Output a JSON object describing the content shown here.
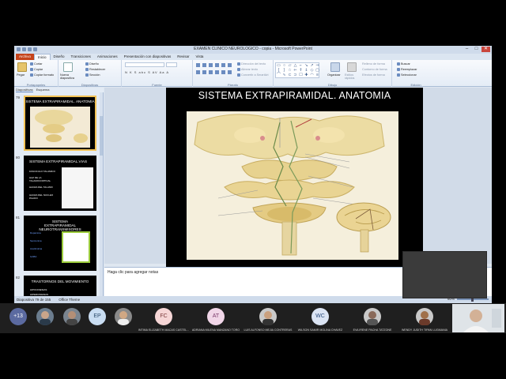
{
  "window": {
    "title": "EXAMEN CLINICO NEUROLOGICO - copia - Microsoft PowerPoint",
    "controls": [
      "–",
      "□",
      "✕"
    ]
  },
  "tabs": [
    "Archivo",
    "Inicio",
    "Diseño",
    "Transiciones",
    "Animaciones",
    "Presentación con diapositivas",
    "Revisar",
    "Vista"
  ],
  "ribbon": {
    "clipboard": {
      "paste": "Pegar",
      "cut": "Cortar",
      "copy": "Copiar",
      "copy_format": "Copiar formato",
      "label": "Portapapeles"
    },
    "slides": {
      "new_slide": "Nueva diapositiva",
      "layout": "Diseño",
      "reset": "Restablecer",
      "section": "Sección",
      "label": "Diapositivas"
    },
    "font": {
      "label": "Fuente",
      "format_row": "N K S abc S AV Aa A"
    },
    "paragraph": {
      "label": "Párrafo",
      "text_dir": "Dirección del texto",
      "align_text": "Alinear texto",
      "smartart": "Convertir a SmartArt"
    },
    "drawing": {
      "label": "Dibujo",
      "arrange": "Organizar",
      "quick_styles": "Estilos rápidos",
      "fill": "Relleno de forma",
      "outline": "Contorno de forma",
      "effects": "Efectos de forma"
    },
    "editing": {
      "label": "Edición",
      "find": "Buscar",
      "replace": "Reemplazar",
      "select": "Seleccionar"
    }
  },
  "panel_tabs": [
    "Diapositivas",
    "Esquema"
  ],
  "thumbnails": [
    {
      "num": "79",
      "title": "SISTEMA EXTRAPIRAMIDAL. ANATOMIA",
      "selected": true
    },
    {
      "num": "80",
      "title": "SISTEMA EXTRAPIRAMIDAL.VIAS",
      "bullets": [
        "FASCICULO TALAMICO",
        "HAZ DE LA TALAMOCORTICAL",
        "HACES DEL TALAMO",
        "HACES DEL NUCLEO PALIDO"
      ],
      "selected": false
    },
    {
      "num": "81",
      "title": "SISTEMA EXTRAPIRAMIDAL NEUROTRANSMISORES",
      "bullets": [
        "Dopamina",
        "Serotonina",
        "Acetilcolina",
        "GABA"
      ],
      "selected": false
    },
    {
      "num": "82",
      "title": "TRASTORNOS DEL MOVIMIENTO",
      "bullets": [
        "HIPOCINESIAS",
        "HIPERCINESIAS"
      ],
      "selected": false
    }
  ],
  "slide": {
    "title": "SISTEMA EXTRAPIRAMIDAL. ANATOMIA"
  },
  "notes_placeholder": "Haga clic para agregar notas",
  "status": {
    "slide_info": "Diapositiva 79 de 155",
    "theme": "Office Theme",
    "zoom": "60%"
  },
  "meeting": {
    "overflow": "+13",
    "small_tiles": [
      "EP"
    ],
    "participants": [
      {
        "initials": "FC",
        "name": "INTIMA ELIZABETH MACAS CASTEL...",
        "color": "#f6d6d6"
      },
      {
        "initials": "AT",
        "name": "ADRIANA MILENA MANZANO TORO",
        "color": "#f1d6e8"
      },
      {
        "initials": "",
        "name": "LUIS ALFONSO MEJIA CONTRERAS",
        "color": "#c9c9c9"
      },
      {
        "initials": "WC",
        "name": "WILSON SAMIR MOLINA CHAVEZ",
        "color": "#dbe4f3"
      },
      {
        "initials": "",
        "name": "EVA IRENE PACHA TATZONE",
        "color": "#c9c9c9"
      },
      {
        "initials": "",
        "name": "WENDY JUDITH TIPAN LUGMANIA",
        "color": "#c9c9c9"
      }
    ]
  }
}
